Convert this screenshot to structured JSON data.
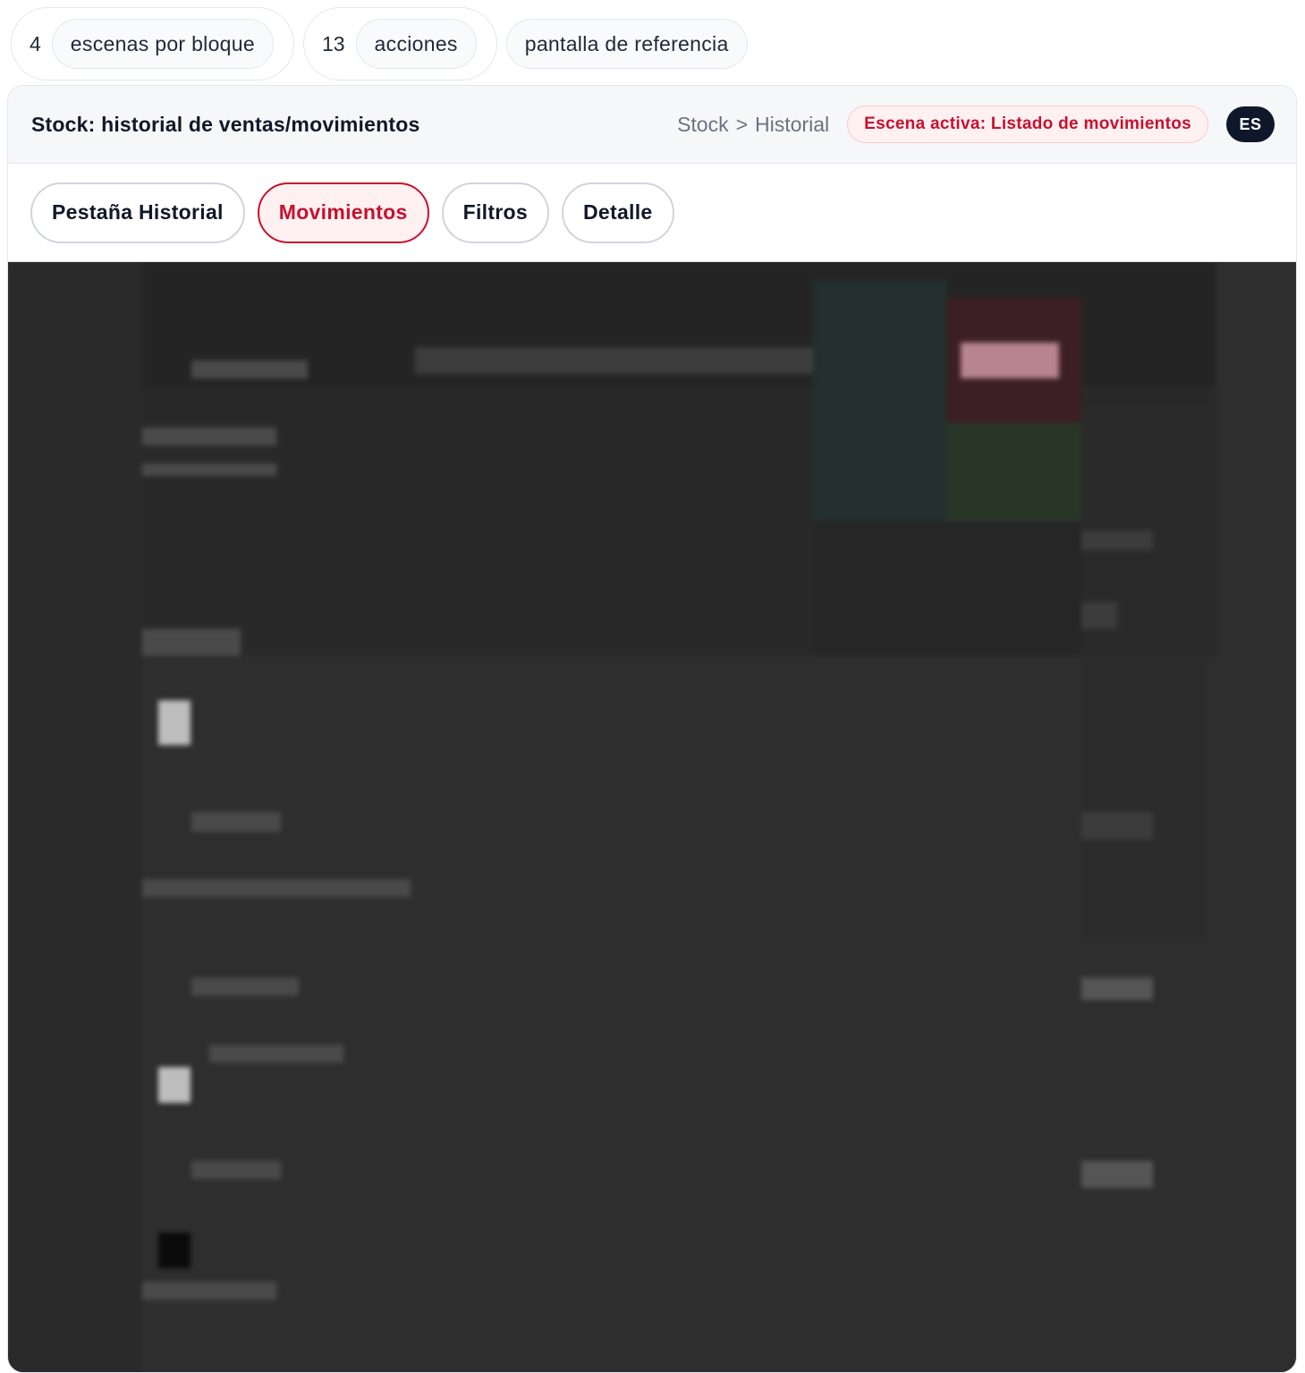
{
  "stats": {
    "scenes": {
      "count": "4",
      "label": "escenas por bloque"
    },
    "actions": {
      "count": "13",
      "label": "acciones"
    },
    "reference_label": "pantalla de referencia"
  },
  "header": {
    "title": "Stock: historial de ventas/movimientos",
    "breadcrumb": {
      "root": "Stock",
      "separator": ">",
      "current": "Historial"
    },
    "active_scene": "Escena activa: Listado de movimientos",
    "language": "ES"
  },
  "tabs": [
    {
      "label": "Pestaña Historial",
      "active": false
    },
    {
      "label": "Movimientos",
      "active": true
    },
    {
      "label": "Filtros",
      "active": false
    },
    {
      "label": "Detalle",
      "active": false
    }
  ],
  "colors": {
    "accent": "#c8102e",
    "accent_bg": "#fff1f2",
    "screen_bg": "#2f2f2f",
    "lang_badge_bg": "#0f172a"
  }
}
